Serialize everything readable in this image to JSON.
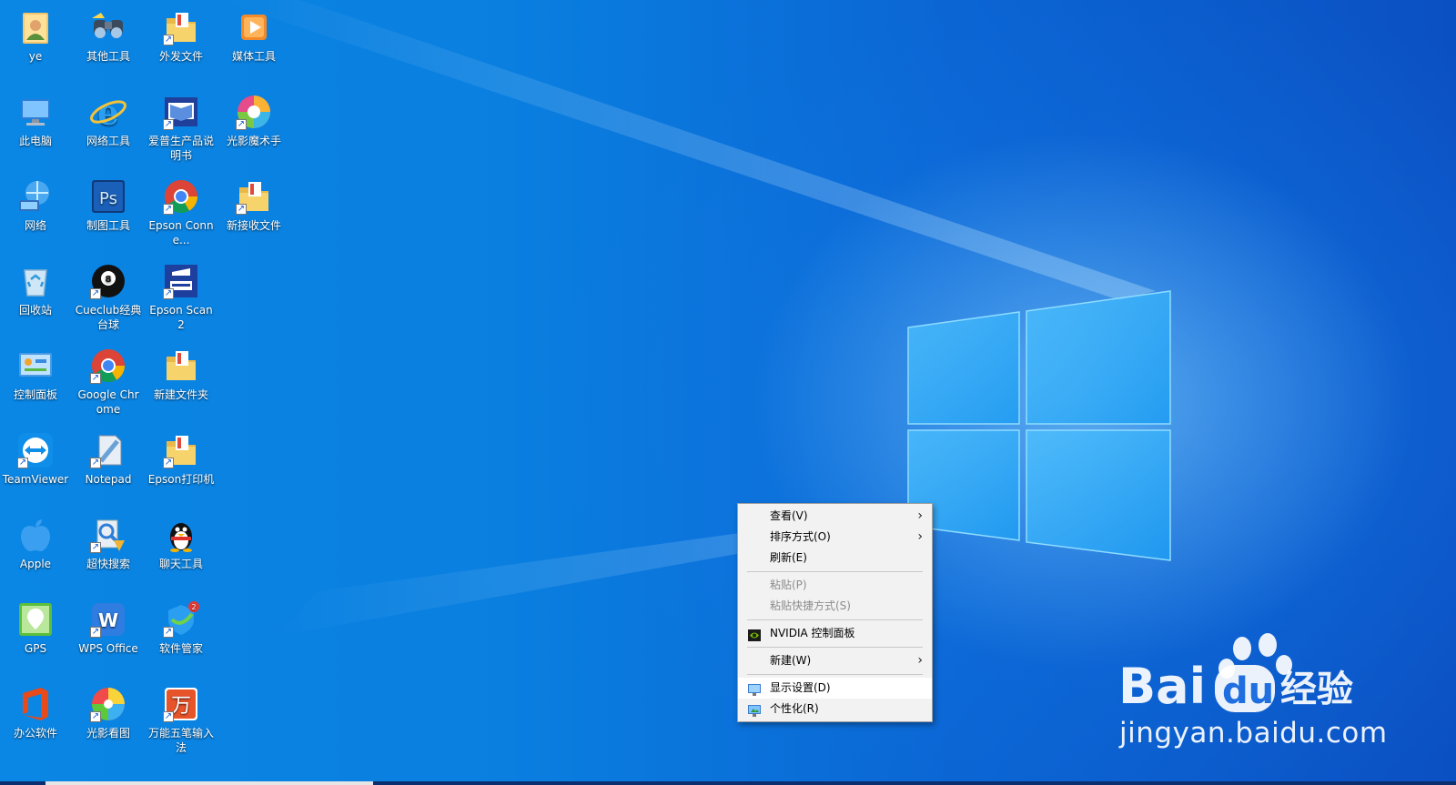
{
  "desktop": {
    "icons": [
      {
        "label": "ye",
        "icon": "user-folder-icon",
        "shortcut": false
      },
      {
        "label": "其他工具",
        "icon": "binoculars-icon",
        "shortcut": false
      },
      {
        "label": "外发文件",
        "icon": "folder-icon",
        "shortcut": true
      },
      {
        "label": "媒体工具",
        "icon": "media-player-icon",
        "shortcut": false
      },
      {
        "label": "此电脑",
        "icon": "computer-icon",
        "shortcut": false
      },
      {
        "label": "网络工具",
        "icon": "internet-explorer-icon",
        "shortcut": false
      },
      {
        "label": "爱普生产品说明书",
        "icon": "epson-manual-icon",
        "shortcut": true
      },
      {
        "label": "光影魔术手",
        "icon": "photo-editor-icon",
        "shortcut": true
      },
      {
        "label": "网络",
        "icon": "network-globe-icon",
        "shortcut": false
      },
      {
        "label": "制图工具",
        "icon": "photoshop-icon",
        "shortcut": false
      },
      {
        "label": "Epson Conne...",
        "icon": "chrome-icon",
        "shortcut": true
      },
      {
        "label": "新接收文件",
        "icon": "folder-icon",
        "shortcut": true
      },
      {
        "label": "回收站",
        "icon": "recycle-bin-icon",
        "shortcut": false
      },
      {
        "label": "Cueclub经典台球",
        "icon": "billiard-ball-icon",
        "shortcut": true
      },
      {
        "label": "Epson Scan 2",
        "icon": "scanner-icon",
        "shortcut": true
      },
      {
        "label": "",
        "icon": "",
        "shortcut": false
      },
      {
        "label": "控制面板",
        "icon": "control-panel-icon",
        "shortcut": false
      },
      {
        "label": "Google Chrome",
        "icon": "chrome-icon",
        "shortcut": true
      },
      {
        "label": "新建文件夹",
        "icon": "folder-icon",
        "shortcut": false
      },
      {
        "label": "",
        "icon": "",
        "shortcut": false
      },
      {
        "label": "TeamViewer",
        "icon": "teamviewer-icon",
        "shortcut": true
      },
      {
        "label": "Notepad",
        "icon": "notepad-icon",
        "shortcut": true
      },
      {
        "label": "Epson打印机",
        "icon": "folder-icon",
        "shortcut": true
      },
      {
        "label": "",
        "icon": "",
        "shortcut": false
      },
      {
        "label": "Apple",
        "icon": "apple-icon",
        "shortcut": false
      },
      {
        "label": "超快搜索",
        "icon": "search-tool-icon",
        "shortcut": true
      },
      {
        "label": "聊天工具",
        "icon": "qq-penguin-icon",
        "shortcut": false
      },
      {
        "label": "",
        "icon": "",
        "shortcut": false
      },
      {
        "label": "GPS",
        "icon": "gps-icon",
        "shortcut": false
      },
      {
        "label": "WPS Office",
        "icon": "wps-office-icon",
        "shortcut": true
      },
      {
        "label": "软件管家",
        "icon": "software-manager-icon",
        "shortcut": true
      },
      {
        "label": "",
        "icon": "",
        "shortcut": false
      },
      {
        "label": "办公软件",
        "icon": "office-icon",
        "shortcut": false
      },
      {
        "label": "光影看图",
        "icon": "photo-viewer-icon",
        "shortcut": true
      },
      {
        "label": "万能五笔输入法",
        "icon": "wubi-input-icon",
        "shortcut": true
      }
    ]
  },
  "context_menu": {
    "items": [
      {
        "label": "查看(V)",
        "submenu": true,
        "disabled": false,
        "icon": ""
      },
      {
        "label": "排序方式(O)",
        "submenu": true,
        "disabled": false,
        "icon": ""
      },
      {
        "label": "刷新(E)",
        "submenu": false,
        "disabled": false,
        "icon": ""
      },
      {
        "separator": true
      },
      {
        "label": "粘贴(P)",
        "submenu": false,
        "disabled": true,
        "icon": ""
      },
      {
        "label": "粘贴快捷方式(S)",
        "submenu": false,
        "disabled": true,
        "icon": ""
      },
      {
        "separator": true
      },
      {
        "label": "NVIDIA 控制面板",
        "submenu": false,
        "disabled": false,
        "icon": "nvidia-icon"
      },
      {
        "separator": true
      },
      {
        "label": "新建(W)",
        "submenu": true,
        "disabled": false,
        "icon": ""
      },
      {
        "separator": true
      },
      {
        "label": "显示设置(D)",
        "submenu": false,
        "disabled": false,
        "icon": "display-settings-icon",
        "highlight": true
      },
      {
        "label": "个性化(R)",
        "submenu": false,
        "disabled": false,
        "icon": "personalize-icon"
      }
    ]
  },
  "watermark": {
    "brand": "Bai",
    "brand_du": "du",
    "suffix": "经验",
    "url": "jingyan.baidu.com"
  },
  "colors": {
    "background_left": "#0a86e4",
    "background_right": "#0b50c3",
    "menu_bg": "#f2f2f2",
    "menu_highlight": "#ffffff",
    "nvidia_green": "#76b900"
  }
}
